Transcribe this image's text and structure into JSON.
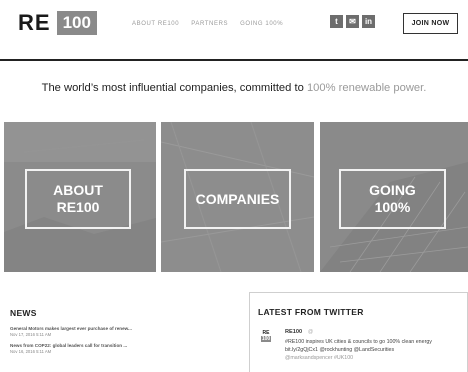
{
  "header": {
    "logo_text": "RE",
    "logo_box": "100",
    "nav": [
      "ABOUT RE100",
      "PARTNERS",
      "GOING 100%"
    ],
    "social": [
      {
        "icon": "twitter-icon",
        "glyph": "t"
      },
      {
        "icon": "email-icon",
        "glyph": "✉"
      },
      {
        "icon": "linkedin-icon",
        "glyph": "in"
      }
    ],
    "join_label": "JOIN NOW"
  },
  "tagline": {
    "text": "The world’s most influential companies, committed to ",
    "accent": "100% renewable power."
  },
  "tiles": {
    "about": {
      "line1": "ABOUT",
      "line2": "RE100"
    },
    "companies": {
      "label": "COMPANIES"
    },
    "going": {
      "line1": "GOING",
      "line2": "100%"
    }
  },
  "news": {
    "title": "NEWS",
    "items": [
      {
        "headline": "General Motors makes largest ever purchase of renew...",
        "date": "Nov 17, 2016 5:11 AM"
      },
      {
        "headline": "News from COP22: global leaders call for transition ...",
        "date": "Nov 16, 2016 5:11 AM"
      }
    ]
  },
  "twitter": {
    "title": "LATEST FROM TWITTER",
    "logo_top": "RE",
    "logo_bottom": "100",
    "author": "RE100",
    "handle": "@",
    "text_line": "#RE100 inspires UK cities & councils to go 100% clean energy bit.ly/2gQjCx1 @rockhunting @LandSecurities",
    "text_tail": "@marksandspencer #UK100"
  },
  "colors": {
    "tile_gray": "#8b8b8b",
    "accent_gray": "#9a9a9a",
    "rule": "#222222"
  }
}
